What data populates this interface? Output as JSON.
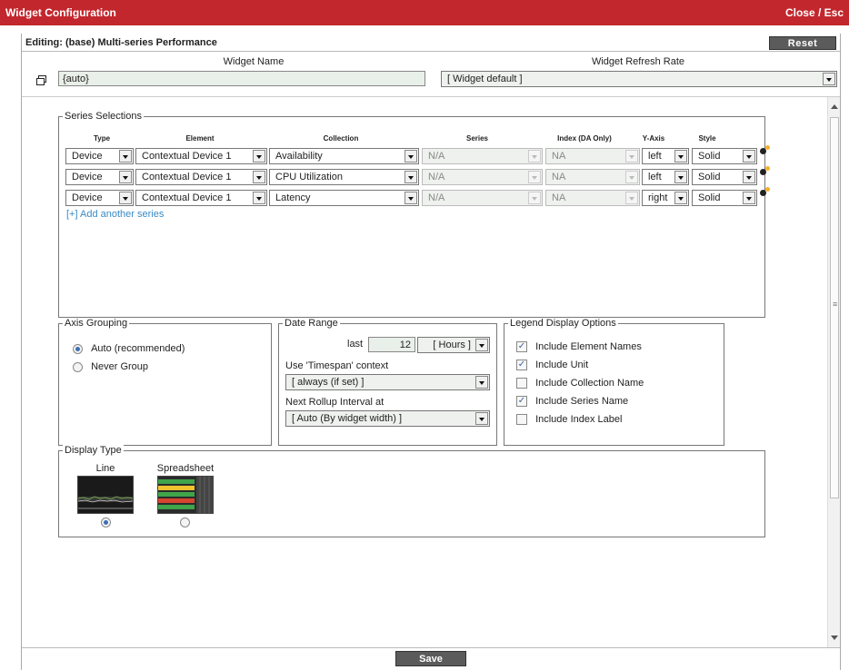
{
  "window": {
    "title": "Widget Configuration",
    "close_label": "Close / Esc"
  },
  "editing": {
    "title": "Editing: (base) Multi-series Performance",
    "reset_label": "Reset"
  },
  "widget_name": {
    "label": "Widget Name",
    "value": "{auto}"
  },
  "refresh_rate": {
    "label": "Widget Refresh Rate",
    "value": "[ Widget default ]"
  },
  "series_selections": {
    "legend": "Series Selections",
    "headers": [
      "Type",
      "Element",
      "Collection",
      "Series",
      "Index (DA Only)",
      "Y-Axis",
      "Style"
    ],
    "rows": [
      {
        "type": "Device",
        "element": "Contextual Device 1",
        "collection": "Availability",
        "series": "N/A",
        "index": "NA",
        "y_axis": "left",
        "style": "Solid"
      },
      {
        "type": "Device",
        "element": "Contextual Device 1",
        "collection": "CPU Utilization",
        "series": "N/A",
        "index": "NA",
        "y_axis": "left",
        "style": "Solid"
      },
      {
        "type": "Device",
        "element": "Contextual Device 1",
        "collection": "Latency",
        "series": "N/A",
        "index": "NA",
        "y_axis": "right",
        "style": "Solid"
      }
    ],
    "add_link": "[+] Add another series"
  },
  "axis_grouping": {
    "legend": "Axis Grouping",
    "options": [
      {
        "label": "Auto (recommended)",
        "checked": true
      },
      {
        "label": "Never Group",
        "checked": false
      }
    ]
  },
  "date_range": {
    "legend": "Date Range",
    "last_label": "last",
    "last_value": "12",
    "unit": "[ Hours ]",
    "timespan_label": "Use 'Timespan' context",
    "timespan_value": "[ always (if set) ]",
    "rollup_label": "Next Rollup Interval at",
    "rollup_value": "[ Auto (By widget width) ]"
  },
  "legend_options": {
    "legend": "Legend Display Options",
    "options": [
      {
        "label": "Include Element Names",
        "checked": true
      },
      {
        "label": "Include Unit",
        "checked": true
      },
      {
        "label": "Include Collection Name",
        "checked": false
      },
      {
        "label": "Include Series Name",
        "checked": true
      },
      {
        "label": "Include Index Label",
        "checked": false
      }
    ]
  },
  "display_type": {
    "legend": "Display Type",
    "options": [
      {
        "label": "Line",
        "checked": true
      },
      {
        "label": "Spreadsheet",
        "checked": false
      }
    ]
  },
  "footer": {
    "save_label": "Save"
  },
  "colors": {
    "title_bar": "#c2272d",
    "link": "#3a8ac4",
    "field_bg": "#e9efe9"
  }
}
